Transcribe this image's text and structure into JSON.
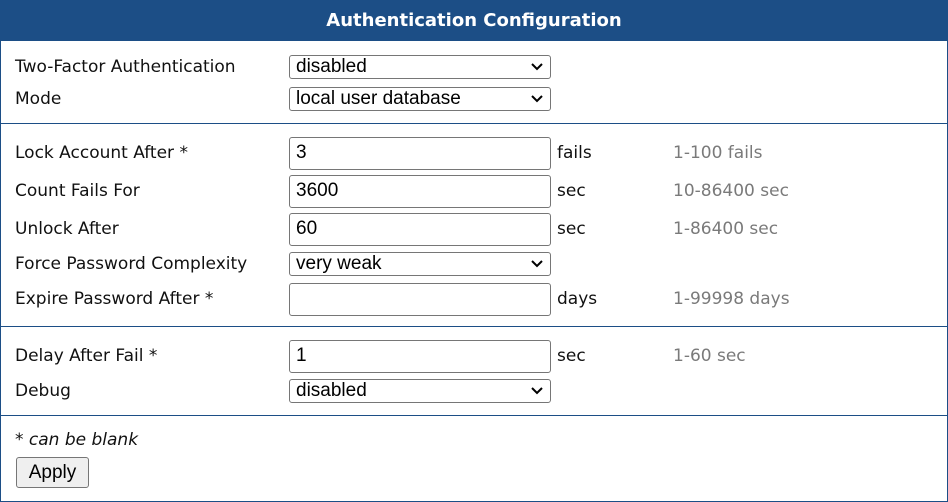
{
  "header": {
    "title": "Authentication Configuration"
  },
  "fields": {
    "two_factor": {
      "label": "Two-Factor Authentication",
      "value": "disabled"
    },
    "mode": {
      "label": "Mode",
      "value": "local user database"
    },
    "lock_after": {
      "label": "Lock Account After *",
      "value": "3",
      "unit": "fails",
      "hint": "1-100 fails"
    },
    "count_fails": {
      "label": "Count Fails For",
      "value": "3600",
      "unit": "sec",
      "hint": "10-86400 sec"
    },
    "unlock_after": {
      "label": "Unlock After",
      "value": "60",
      "unit": "sec",
      "hint": "1-86400 sec"
    },
    "complexity": {
      "label": "Force Password Complexity",
      "value": "very weak"
    },
    "expire": {
      "label": "Expire Password After *",
      "value": "",
      "unit": "days",
      "hint": "1-99998 days"
    },
    "delay": {
      "label": "Delay After Fail *",
      "value": "1",
      "unit": "sec",
      "hint": "1-60 sec"
    },
    "debug": {
      "label": "Debug",
      "value": "disabled"
    }
  },
  "footer": {
    "note": "* can be blank",
    "apply_label": "Apply"
  },
  "icons": {
    "dropdown": "chevron-down-icon"
  },
  "colors": {
    "header_bg": "#1c4e86",
    "hint": "#7a7a7a"
  }
}
